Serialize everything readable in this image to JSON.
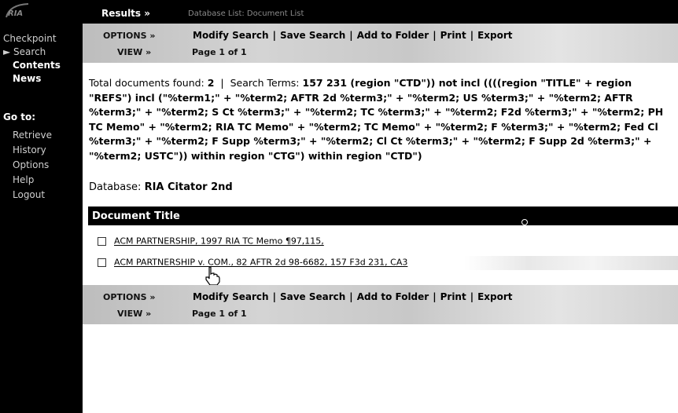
{
  "sidebar": {
    "logo_text": "RIA",
    "top_items": [
      {
        "label": "Checkpoint"
      },
      {
        "label": "► Search"
      },
      {
        "label": "Contents"
      },
      {
        "label": "News"
      }
    ],
    "goto_label": "Go to:",
    "bottom_items": [
      {
        "label": "Retrieve"
      },
      {
        "label": "History"
      },
      {
        "label": "Options"
      },
      {
        "label": "Help"
      },
      {
        "label": "Logout"
      }
    ]
  },
  "topbar": {
    "results_label": "Results »",
    "database_list": "Database List: Document List"
  },
  "options": {
    "options_label": "OPTIONS »",
    "view_label": "VIEW »",
    "actions": [
      "Modify Search",
      "Save Search",
      "Add to Folder",
      "Print",
      "Export"
    ],
    "pager": "Page 1 of 1"
  },
  "summary": {
    "total_label": "Total documents found:",
    "total_count": "2",
    "separator": "|",
    "terms_label": "Search Terms:",
    "terms_text": "157 231 (region \"CTD\")) not incl ((((region \"TITLE\" + region \"REFS\") incl (\"%term1;\" + \"%term2; AFTR 2d %term3;\" + \"%term2; US %term3;\" + \"%term2; AFTR %term3;\" + \"%term2; S Ct %term3;\" + \"%term2; TC %term3;\" + \"%term2; F2d %term3;\" + \"%term2; PH TC Memo\" + \"%term2; RIA TC Memo\" + \"%term2; TC Memo\" + \"%term2; F %term3;\" + \"%term2; Fed Cl %term3;\" + \"%term2; F Supp %term3;\" + \"%term2; Cl Ct %term3;\" + \"%term2; F Supp 2d %term3;\" + \"%term2; USTC\")) within region \"CTG\") within region \"CTD\")"
  },
  "database": {
    "label": "Database:",
    "name": "RIA Citator 2nd"
  },
  "doc_list": {
    "header": "Document Title",
    "rows": [
      {
        "title": "ACM PARTNERSHIP, 1997 RIA TC Memo ¶97,115,"
      },
      {
        "title": "ACM PARTNERSHIP v. COM., 82 AFTR 2d 98-6682, 157 F3d 231, CA3"
      }
    ]
  },
  "colors": {
    "sidebar_bg": "#000000",
    "strip_bg": "#c8c8c8",
    "header_bg": "#000000"
  }
}
